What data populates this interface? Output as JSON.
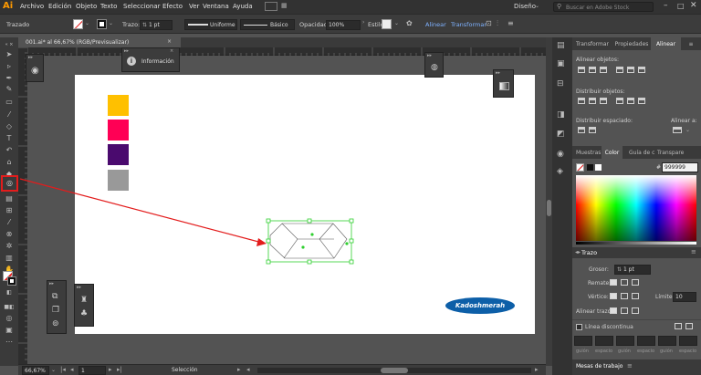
{
  "app": {
    "logo_text": "Ai",
    "menus": [
      "Archivo",
      "Edición",
      "Objeto",
      "Texto",
      "Seleccionar",
      "Efecto",
      "Ver",
      "Ventana",
      "Ayuda"
    ],
    "workspace": "Diseño",
    "search_placeholder": "Buscar en Adobe Stock"
  },
  "control_bar": {
    "selection_label": "Trazado",
    "stroke_label": "Trazo:",
    "stroke_value": "1 pt",
    "stroke_profile": "Uniforme",
    "brush_profile": "Básico",
    "opacity_label": "Opacidad:",
    "opacity_value": "100%",
    "style_label": "Estilo:",
    "align_label": "Alinear",
    "transform_label": "Transformar"
  },
  "document": {
    "tab_title": "001.ai* al 66,67% (RGB/Previsualizar)",
    "close_glyph": "×"
  },
  "info_panel": {
    "title": "Información"
  },
  "canvas": {
    "swatch_colors": [
      "#ffc000",
      "#ff0055",
      "#4a0a6e",
      "#999999"
    ],
    "logo_text": "Kadoshmerah",
    "accent_red": "#e31c1c",
    "selection_green": "#2fcf2f"
  },
  "status_bar": {
    "zoom": "66,67%",
    "page": "1",
    "tool_status": "Selección"
  },
  "right_panel": {
    "top_tabs": [
      "Transformar",
      "Propiedades",
      "Alinear"
    ],
    "align_objects": "Alinear objetos:",
    "distribute_objects": "Distribuir objetos:",
    "distribute_spacing": "Distribuir espaciado:",
    "align_to": "Alinear a:",
    "color_tabs": [
      "Muestras",
      "Color",
      "Guía de c",
      "Transpare"
    ],
    "hex_prefix": "#",
    "hex_value": "999999",
    "stroke_title": "Trazo",
    "weight_label": "Grosor:",
    "weight_value": "1 pt",
    "cap_label": "Remate:",
    "corner_label": "Vértice:",
    "limit_label": "Límite:",
    "limit_value": "10",
    "align_stroke_label": "Alinear trazo:",
    "dashed_label": "Línea discontinua",
    "dash_labels": [
      "guión",
      "espacio",
      "guión",
      "espacio",
      "guión",
      "espacio"
    ],
    "artboards_tab": "Mesas de trabajo"
  }
}
